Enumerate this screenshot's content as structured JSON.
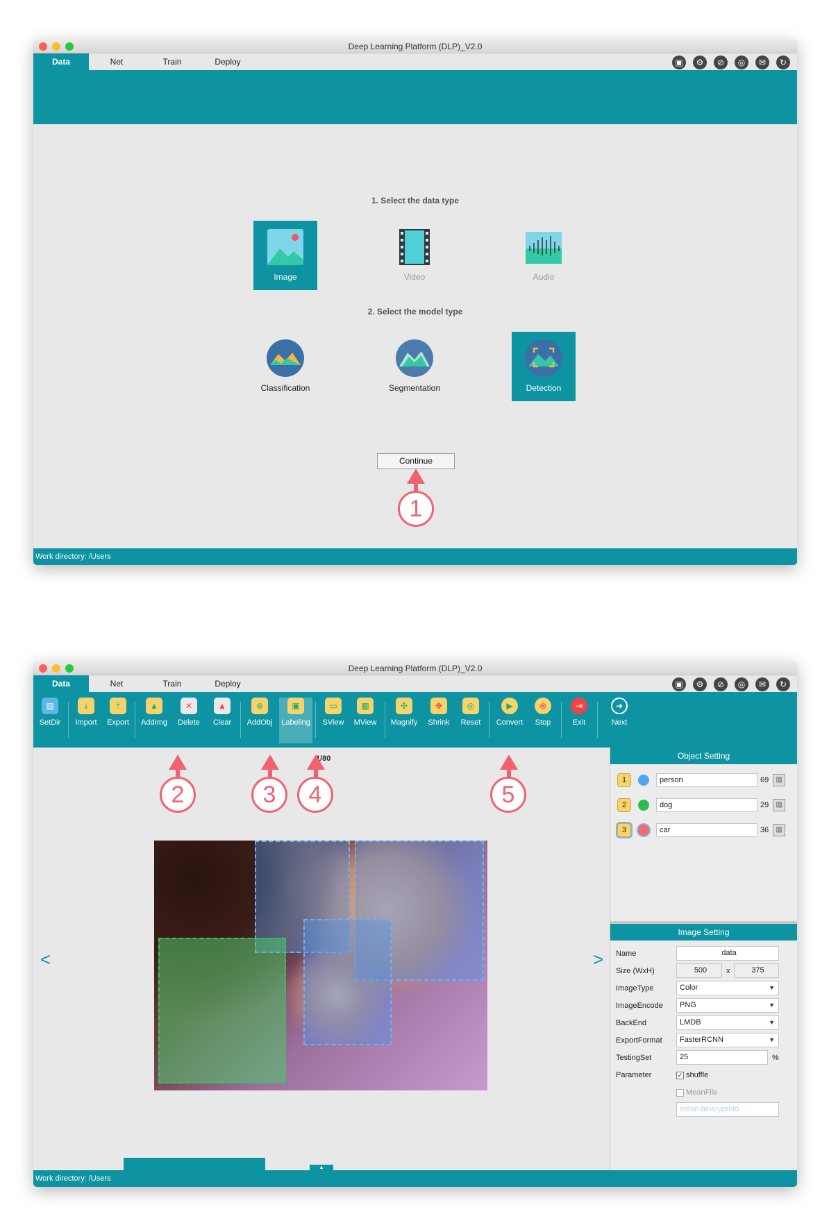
{
  "app_title": "Deep Learning Platform (DLP)_V2.0",
  "tabs": [
    "Data",
    "Net",
    "Train",
    "Deploy"
  ],
  "tab_icons": [
    "save-icon",
    "settings-icon",
    "compass-icon",
    "wechat-icon",
    "mail-icon",
    "refresh-icon"
  ],
  "status_text": "Work directory: /Users",
  "window1": {
    "step1_heading": "1. Select the data type",
    "data_types": [
      {
        "label": "Image",
        "selected": true
      },
      {
        "label": "Video",
        "selected": false
      },
      {
        "label": "Audio",
        "selected": false
      }
    ],
    "step2_heading": "2. Select the model type",
    "model_types": [
      {
        "label": "Classification",
        "selected": false
      },
      {
        "label": "Segmentation",
        "selected": false
      },
      {
        "label": "Detection",
        "selected": true
      }
    ],
    "continue_label": "Continue",
    "callout": "1"
  },
  "window2": {
    "toolbar": [
      "SetDir",
      "Import",
      "Export",
      "AddImg",
      "Delete",
      "Clear",
      "AddObj",
      "Labeling",
      "SView",
      "MView",
      "Magnify",
      "Shrink",
      "Reset",
      "Convert",
      "Stop",
      "Exit",
      "Next"
    ],
    "active_tool": "Labeling",
    "image_counter": "1/80",
    "callouts": [
      "2",
      "3",
      "4",
      "5"
    ],
    "nav_prev": "<",
    "nav_next": ">",
    "object_setting_title": "Object Setting",
    "objects": [
      {
        "index": "1",
        "name": "person",
        "count": "69",
        "color": "#4da6f0"
      },
      {
        "index": "2",
        "name": "dog",
        "count": "29",
        "color": "#2ebc52"
      },
      {
        "index": "3",
        "name": "car",
        "count": "36",
        "color": "#ef6b6b"
      }
    ],
    "image_setting_title": "Image Setting",
    "image_settings": {
      "name_label": "Name",
      "name_value": "data",
      "size_label": "Size (WxH)",
      "width": "500",
      "x": "x",
      "height": "375",
      "image_type_label": "ImageType",
      "image_type": "Color",
      "image_encode_label": "ImageEncode",
      "image_encode": "PNG",
      "backend_label": "BackEnd",
      "backend": "LMDB",
      "export_format_label": "ExportFormat",
      "export_format": "FasterRCNN",
      "testing_set_label": "TestingSet",
      "testing_set": "25",
      "percent": "%",
      "parameter_label": "Parameter",
      "shuffle_label": "shuffle",
      "shuffle_checked": true,
      "meanfile_label": "MeanFile",
      "meanfile_checked": false,
      "meanfile_placeholder": "mean.binaryproto"
    }
  }
}
